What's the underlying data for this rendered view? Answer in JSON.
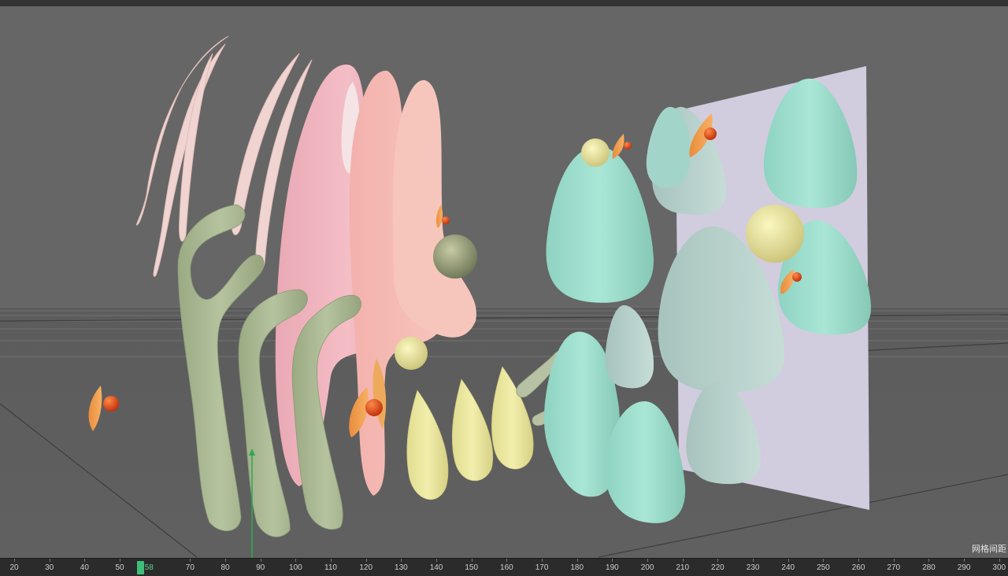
{
  "viewport": {
    "grid_spacing_label": "网格间距",
    "background_color": "#666666",
    "plane_color": "#d2ccdf"
  },
  "timeline": {
    "ticks": [
      "20",
      "30",
      "40",
      "50",
      "70",
      "80",
      "90",
      "100",
      "110",
      "120",
      "130",
      "140",
      "150",
      "160",
      "170",
      "180",
      "190",
      "200",
      "210",
      "220",
      "230",
      "240",
      "250",
      "260",
      "270",
      "280",
      "290",
      "300"
    ],
    "current_frame": "58",
    "playhead_color": "#3fbf7a"
  }
}
